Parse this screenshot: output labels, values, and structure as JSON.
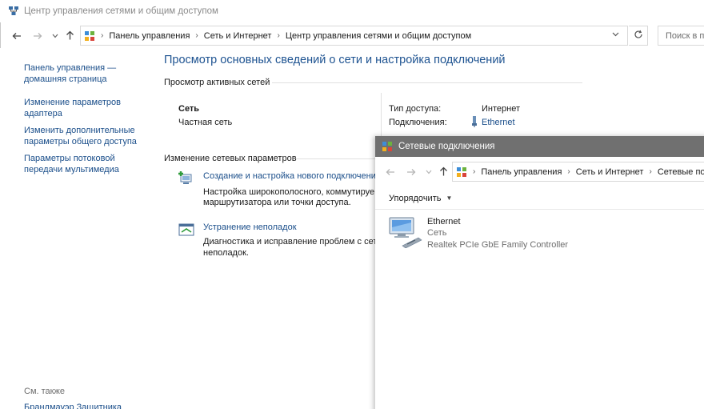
{
  "window": {
    "title": "Центр управления сетями и общим доступом"
  },
  "address": {
    "crumbs": [
      "Панель управления",
      "Сеть и Интернет",
      "Центр управления сетями и общим доступом"
    ],
    "search_placeholder": "Поиск в п"
  },
  "sidebar": {
    "items": [
      "Панель управления —\nдомашняя страница",
      "Изменение параметров\nадаптера",
      "Изменить дополнительные\nпараметры общего доступа",
      "Параметры потоковой\nпередачи мультимедиа"
    ],
    "see_also": "См. также",
    "firewall": "Брандмауэр Защитника"
  },
  "main": {
    "title": "Просмотр основных сведений о сети и настройка подключений",
    "active_networks_header": "Просмотр активных сетей",
    "network": {
      "name": "Сеть",
      "type": "Частная сеть",
      "access_label": "Тип доступа:",
      "access_value": "Интернет",
      "connections_label": "Подключения:",
      "connection_name": "Ethernet"
    },
    "change_settings_header": "Изменение сетевых параметров",
    "tasks": [
      {
        "title": "Создание и настройка нового подключения",
        "desc_line1": "Настройка широкополосного, коммутируе",
        "desc_line2": "маршрутизатора или точки доступа."
      },
      {
        "title": "Устранение неполадок",
        "desc_line1": "Диагностика и исправление проблем с сети",
        "desc_line2": "неполадок."
      }
    ]
  },
  "popup": {
    "title": "Сетевые подключения",
    "crumbs": [
      "Панель управления",
      "Сеть и Интернет",
      "Сетевые по"
    ],
    "toolbar_organize": "Упорядочить",
    "connection": {
      "name": "Ethernet",
      "network": "Сеть",
      "adapter": "Realtek PCIe GbE Family Controller"
    }
  },
  "colors": {
    "link": "#1a4e8a",
    "title_blue": "#1e5391",
    "popup_titlebar": "#707070"
  }
}
